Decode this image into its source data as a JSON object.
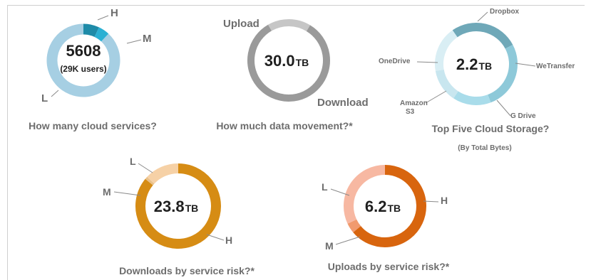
{
  "chart_data": [
    {
      "type": "pie",
      "donut": true,
      "center_value": "5608",
      "center_sub": "(29K users)",
      "caption": "How many cloud services?",
      "categories": [
        "H",
        "M",
        "L"
      ],
      "values": [
        7,
        5,
        88
      ],
      "colors": [
        "#1e8ba8",
        "#2bb0d3",
        "#a6cfe3"
      ]
    },
    {
      "type": "pie",
      "donut": true,
      "center_value": "30.0",
      "center_unit": "TB",
      "caption": "How much data movement?*",
      "categories": [
        "Upload",
        "Download"
      ],
      "values": [
        17,
        83
      ],
      "colors": [
        "#c6c6c6",
        "#9a9a9a"
      ]
    },
    {
      "type": "pie",
      "donut": true,
      "center_value": "2.2",
      "center_unit": "TB",
      "caption": "Top Five Cloud Storage?",
      "subcaption": "(By Total Bytes)",
      "categories": [
        "Dropbox",
        "WeTransfer",
        "G Drive",
        "Amazon S3",
        "OneDrive"
      ],
      "values": [
        27,
        27,
        15,
        13,
        18
      ],
      "colors": [
        "#6fa8b8",
        "#8ec9d9",
        "#a9dcea",
        "#c8e6ef",
        "#d9eef4"
      ]
    },
    {
      "type": "pie",
      "donut": true,
      "center_value": "23.8",
      "center_unit": "TB",
      "caption": "Downloads by service risk?*",
      "categories": [
        "H",
        "L",
        "M"
      ],
      "values": [
        86,
        1,
        13
      ],
      "colors": [
        "#d68c14",
        "#e9c089",
        "#f6d1a6"
      ]
    },
    {
      "type": "pie",
      "donut": true,
      "center_value": "6.2",
      "center_unit": "TB",
      "caption": "Uploads by service risk?*",
      "categories": [
        "H",
        "M",
        "L"
      ],
      "values": [
        64,
        4,
        32
      ],
      "colors": [
        "#d8650e",
        "#f19a6e",
        "#f7b8a2"
      ]
    }
  ]
}
